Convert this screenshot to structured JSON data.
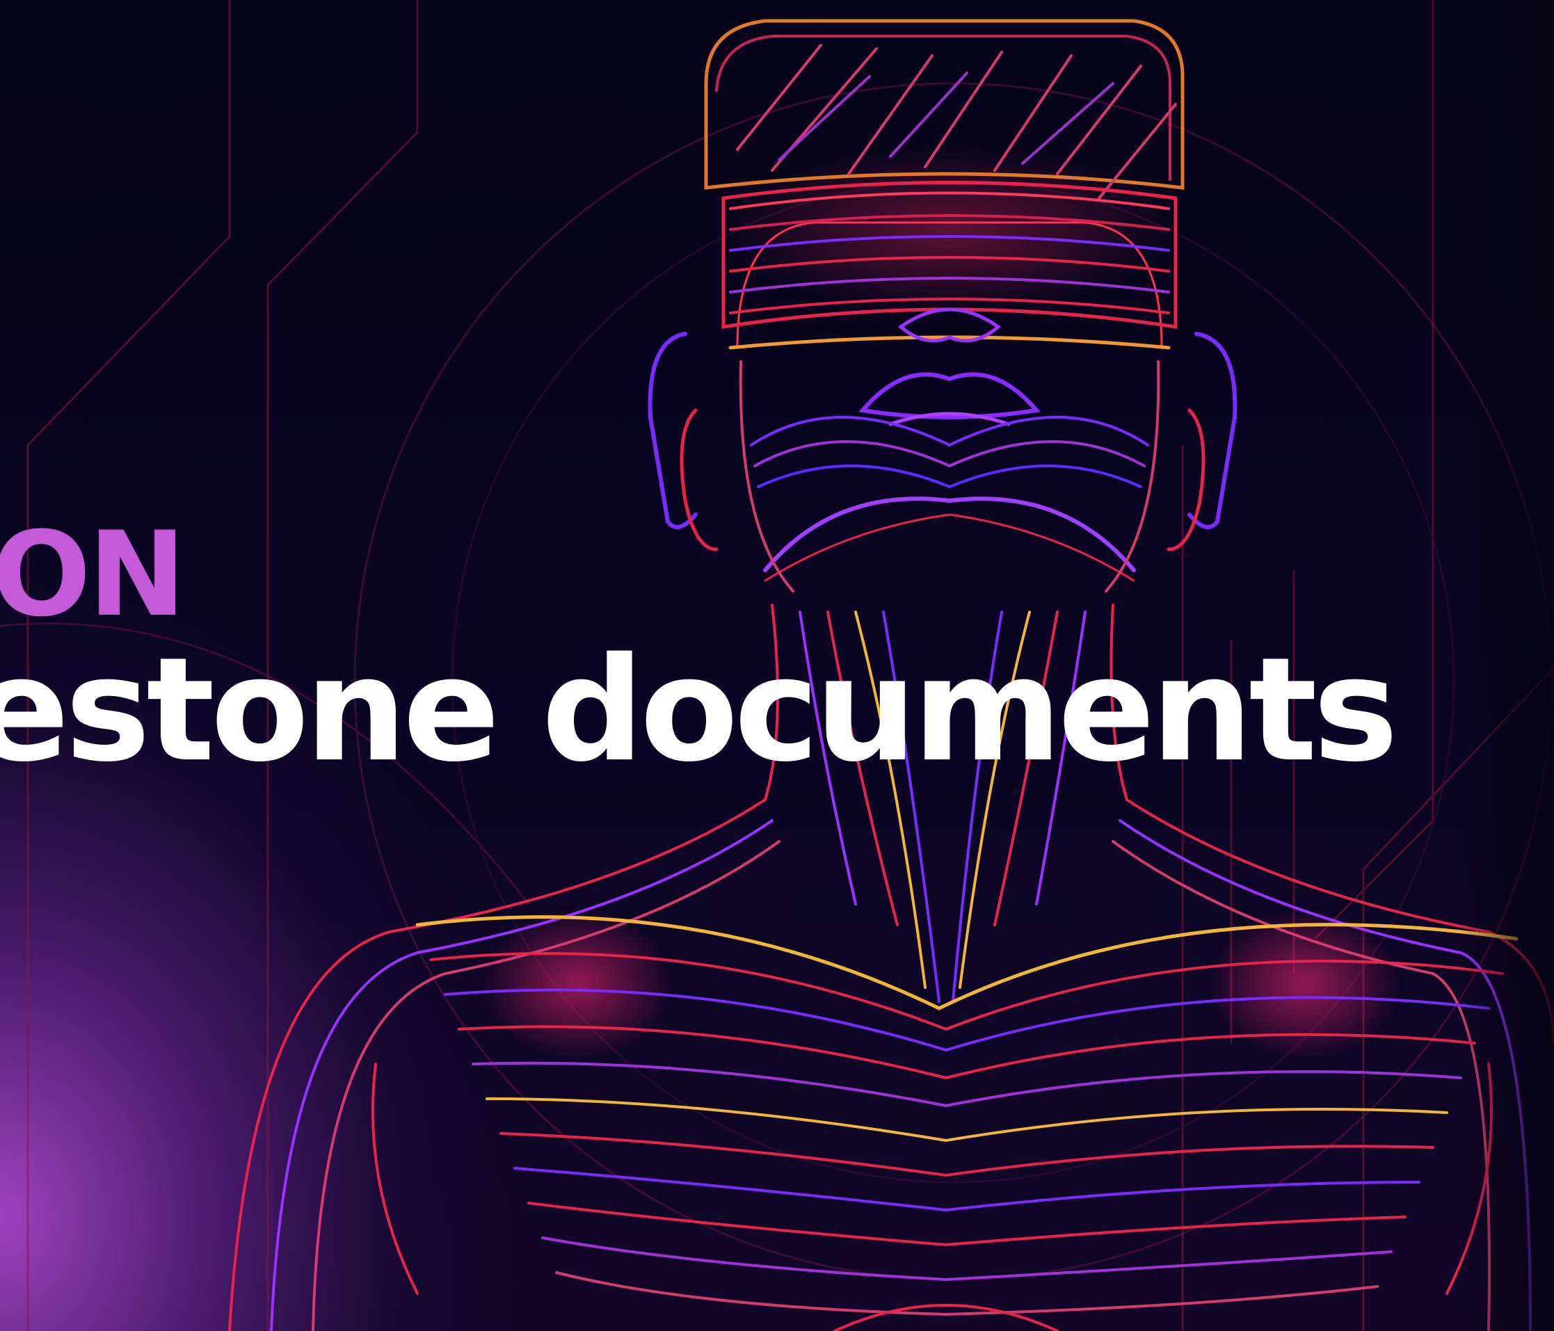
{
  "banner": {
    "accent_text": "ON",
    "headline": "estone documents"
  },
  "colors": {
    "background": "#07041a",
    "accent_text": "#c45ad8",
    "headline_text": "#ffffff",
    "glow": "#a546c8",
    "line_red": "#e8244a",
    "line_violet": "#7a2cff",
    "line_gold": "#f2b63a"
  },
  "illustration": "neon line-art figure wearing a VR headset"
}
